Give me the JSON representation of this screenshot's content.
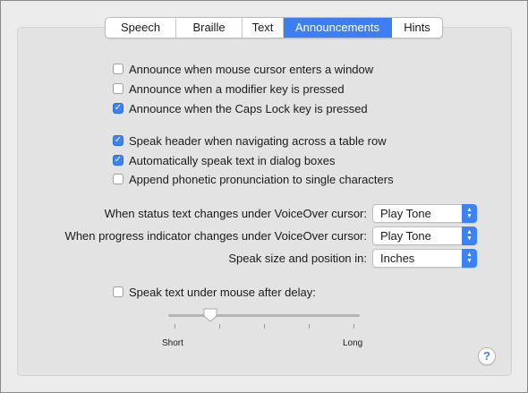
{
  "tabs": [
    {
      "label": "Speech",
      "active": false
    },
    {
      "label": "Braille",
      "active": false
    },
    {
      "label": "Text",
      "active": false
    },
    {
      "label": "Announcements",
      "active": true
    },
    {
      "label": "Hints",
      "active": false
    }
  ],
  "checkboxes": [
    {
      "label": "Announce when mouse cursor enters a window",
      "checked": false
    },
    {
      "label": "Announce when a modifier key is pressed",
      "checked": false
    },
    {
      "label": "Announce when the Caps Lock key is pressed",
      "checked": true
    },
    {
      "label": "Speak header when navigating across a table row",
      "checked": true
    },
    {
      "label": "Automatically speak text in dialog boxes",
      "checked": true
    },
    {
      "label": "Append phonetic pronunciation to single characters",
      "checked": false
    }
  ],
  "popups": [
    {
      "label": "When status text changes under VoiceOver cursor:",
      "value": "Play Tone"
    },
    {
      "label": "When progress indicator changes under VoiceOver cursor:",
      "value": "Play Tone"
    },
    {
      "label": "Speak size and position in:",
      "value": "Inches"
    }
  ],
  "mouse_delay": {
    "label": "Speak text under mouse after delay:",
    "checked": false,
    "slider_min_label": "Short",
    "slider_max_label": "Long",
    "slider_value_fraction": 0.2
  },
  "help": {
    "label": "?"
  },
  "colors": {
    "accent": "#3d7ff2",
    "panel": "#e3e3e3",
    "window": "#ececec"
  }
}
